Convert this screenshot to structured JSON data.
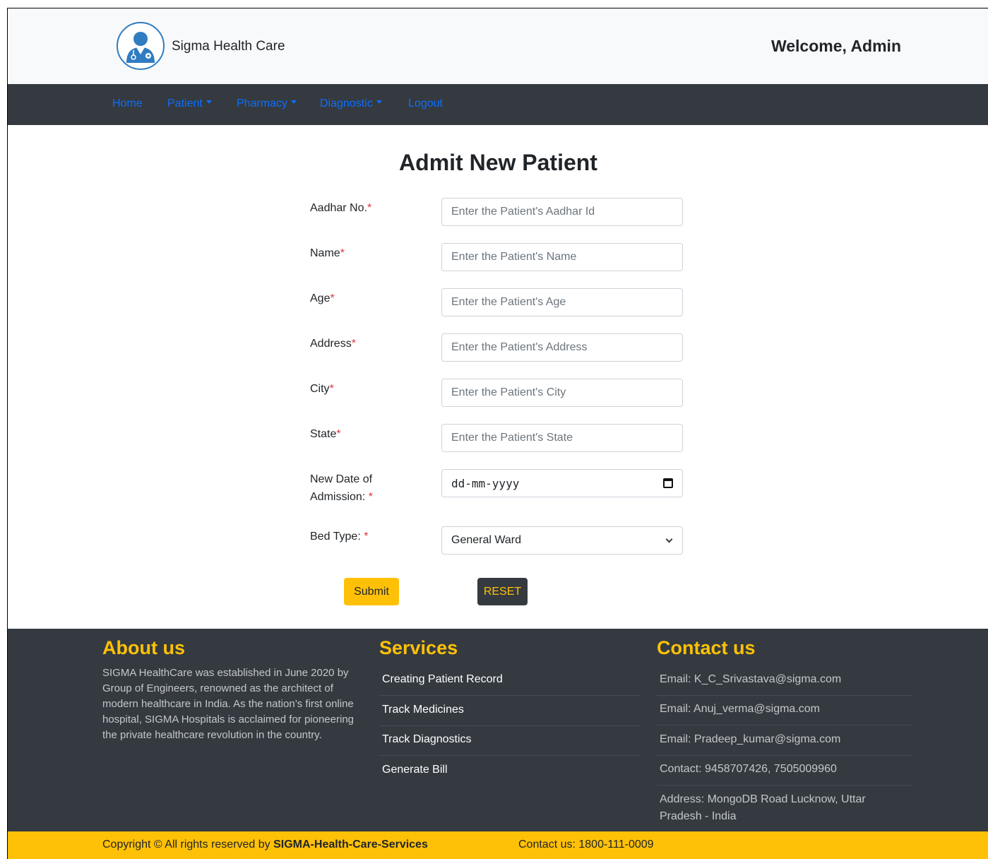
{
  "header": {
    "brand": "Sigma Health Care",
    "welcome": "Welcome, Admin",
    "logo_icon": "doctor-avatar-icon"
  },
  "nav": {
    "home": "Home",
    "patient": "Patient",
    "pharmacy": "Pharmacy",
    "diagnostic": "Diagnostic",
    "logout": "Logout"
  },
  "form": {
    "title": "Admit New Patient",
    "aadhar_label": "Aadhar No.",
    "aadhar_placeholder": "Enter the Patient's Aadhar Id",
    "name_label": "Name",
    "name_placeholder": "Enter the Patient's Name",
    "age_label": "Age",
    "age_placeholder": "Enter the Patient's Age",
    "address_label": "Address",
    "address_placeholder": "Enter the Patient's Address",
    "city_label": "City",
    "city_placeholder": "Enter the Patient's City",
    "state_label": "State",
    "state_placeholder": "Enter the Patient's State",
    "date_label_1": "New Date of",
    "date_label_2": "Admission: ",
    "date_value": "dd-mm-yyyy",
    "bed_label": "Bed Type: ",
    "bed_value": "General Ward",
    "required_mark": "*",
    "submit": "Submit",
    "reset": "RESET"
  },
  "footer": {
    "about_title": "About us",
    "about_text": "SIGMA HealthCare was established in June 2020 by Group of Engineers, renowned as the architect of modern healthcare in India. As the nation’s first online hospital, SIGMA Hospitals is acclaimed for pioneering the private healthcare revolution in the country.",
    "services_title": "Services",
    "services": [
      "Creating Patient Record",
      "Track Medicines",
      "Track Diagnostics",
      "Generate Bill"
    ],
    "contact_title": "Contact us",
    "contacts": [
      "Email: K_C_Srivastava@sigma.com",
      "Email: Anuj_verma@sigma.com",
      "Email: Pradeep_kumar@sigma.com",
      "Contact: 9458707426, 7505009960",
      "Address: MongoDB Road Lucknow, Uttar Pradesh - India"
    ],
    "copyright_prefix": "Copyright © All rights reserved by ",
    "copyright_brand": "SIGMA-Health-Care-Services",
    "copy_contact": "Contact us: 1800-111-0009"
  },
  "colors": {
    "accent": "#ffc107",
    "dark": "#343a40",
    "link": "#0d6efd",
    "required": "#dc3545"
  }
}
